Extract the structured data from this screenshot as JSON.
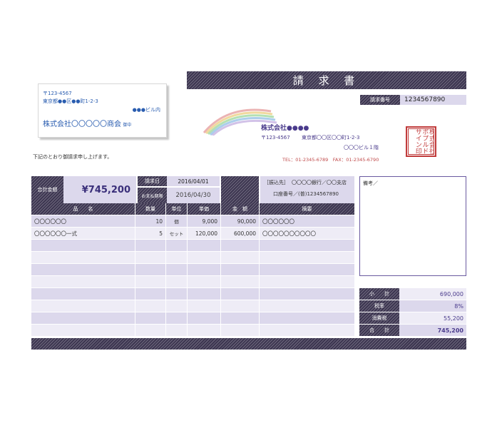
{
  "invoice": {
    "title": "請 求 書",
    "number_label": "請求番号",
    "number_value": "1234567890"
  },
  "recipient": {
    "postal": "〒123-4567",
    "address": "東京都●●区●●町1-2-3",
    "building": "●●●ビル内",
    "company": "株式会社〇〇〇〇〇商会",
    "honorific": "御中"
  },
  "sender": {
    "company": "株式会社●●●●",
    "postal": "〒123-4567",
    "address": "東京都〇〇区〇〇町1-2-3",
    "building": "〇〇〇ビル１階",
    "tel_fax": "TEL：01-2345-6789　FAX：01-2345-6790",
    "seal_text": "株式会社ポプルドサイン印"
  },
  "intro_text": "下記のとおり御請求申し上げます。",
  "summary": {
    "total_label": "合計金額",
    "total_value": "¥745,200",
    "date_label": "請求日",
    "date_value": "2016/04/01",
    "due_label": "お支払期限",
    "due_value": "2016/04/30",
    "bank_prefix": "［振込先］",
    "bank_name": "〇〇〇〇銀行／〇〇支店",
    "account": "口座番号／(普)1234567890"
  },
  "table": {
    "headers": [
      "品　　名",
      "数量",
      "単位",
      "単価",
      "金　額",
      "摘要"
    ],
    "rows": [
      [
        "〇〇〇〇〇〇",
        "10",
        "個",
        "9,000",
        "90,000",
        "〇〇〇〇〇〇"
      ],
      [
        "〇〇〇〇〇〇一式",
        "5",
        "セット",
        "120,000",
        "600,000",
        "〇〇〇〇〇〇〇〇〇〇"
      ],
      [
        "",
        "",
        "",
        "",
        "",
        ""
      ],
      [
        "",
        "",
        "",
        "",
        "",
        ""
      ],
      [
        "",
        "",
        "",
        "",
        "",
        ""
      ],
      [
        "",
        "",
        "",
        "",
        "",
        ""
      ],
      [
        "",
        "",
        "",
        "",
        "",
        ""
      ],
      [
        "",
        "",
        "",
        "",
        "",
        ""
      ],
      [
        "",
        "",
        "",
        "",
        "",
        ""
      ],
      [
        "",
        "",
        "",
        "",
        "",
        ""
      ]
    ]
  },
  "remarks_label": "備考／",
  "totals": [
    {
      "label": "小　　計",
      "value": "690,000"
    },
    {
      "label": "税率",
      "value": "8%"
    },
    {
      "label": "消費税",
      "value": "55,200"
    },
    {
      "label": "合　　計",
      "value": "745,200"
    }
  ],
  "colors": {
    "dark": "#3c3550",
    "lavender": "#dcd8ec",
    "text": "#3a3070",
    "address_blue": "#2a5db0",
    "seal_red": "#c03a3a"
  }
}
